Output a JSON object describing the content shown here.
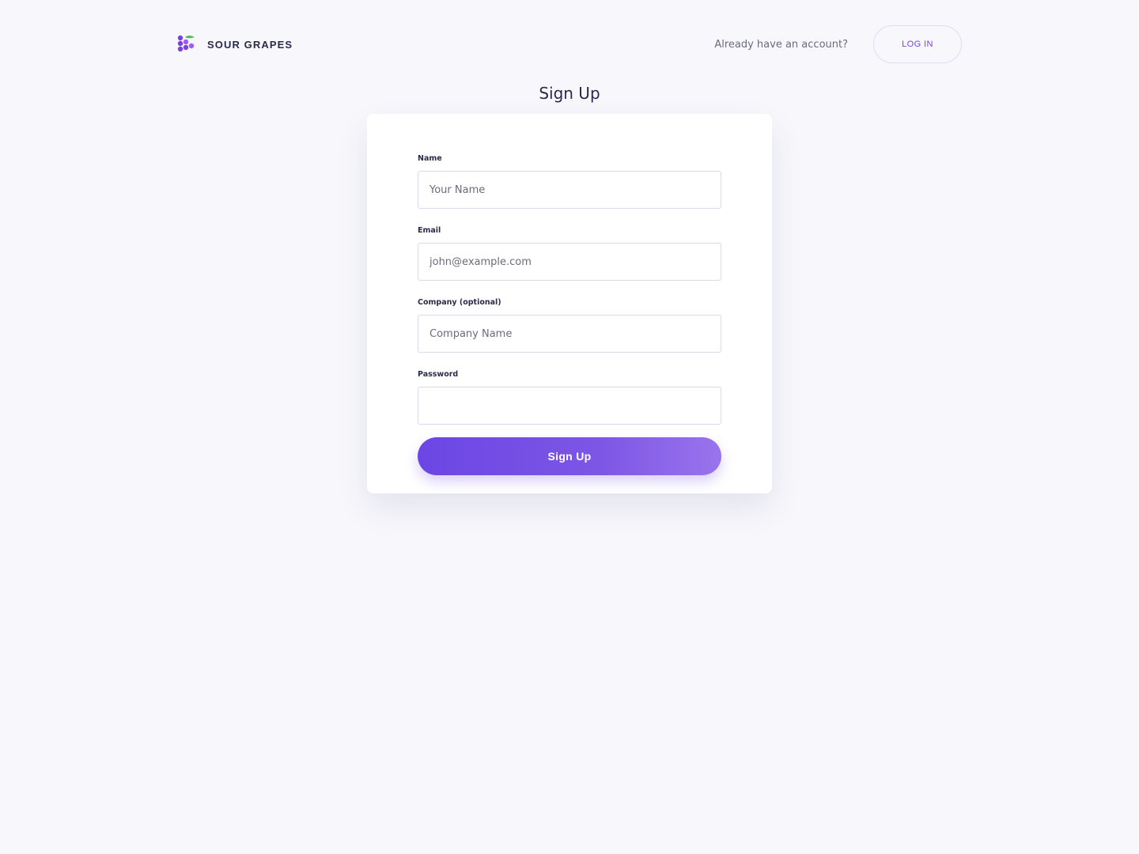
{
  "brand": {
    "name": "SOUR GRAPES",
    "logo_icon": "grapes-icon",
    "colors": {
      "grape": "#7b3fe4",
      "leaf": "#3cc46a"
    }
  },
  "header": {
    "prompt_text": "Already have an account?",
    "login_label": "LOG IN"
  },
  "page": {
    "title": "Sign Up"
  },
  "form": {
    "fields": [
      {
        "label": "Name",
        "placeholder": "Your Name",
        "value": "",
        "type": "text"
      },
      {
        "label": "Email",
        "placeholder": "john@example.com",
        "value": "",
        "type": "email"
      },
      {
        "label": "Company (optional)",
        "placeholder": "Company Name",
        "value": "",
        "type": "text"
      },
      {
        "label": "Password",
        "placeholder": "",
        "value": "",
        "type": "password"
      }
    ],
    "submit_label": "Sign Up"
  },
  "colors": {
    "accent": "#7347e0",
    "background": "#f7f7fc",
    "text": "#2a2a4a"
  }
}
